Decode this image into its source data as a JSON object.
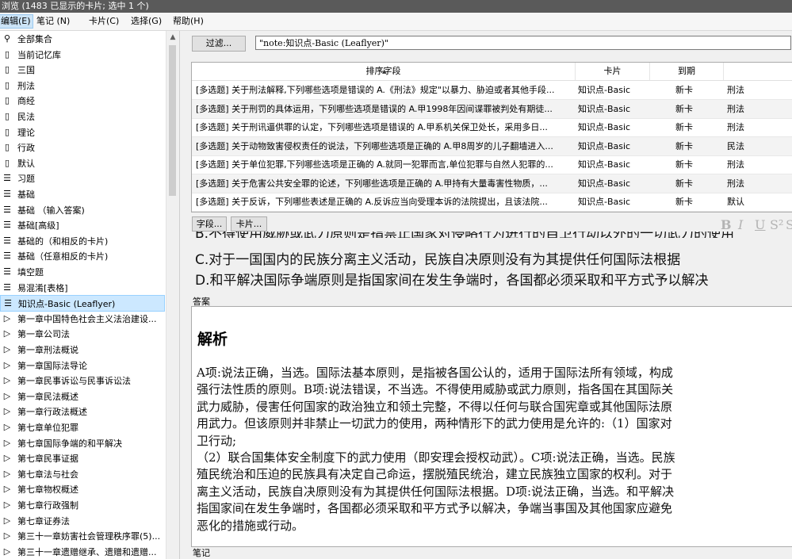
{
  "window": {
    "title": "浏览 (1483 已显示的卡片; 选中 1 个)"
  },
  "menu": [
    {
      "label": "编辑(E)",
      "active": true
    },
    {
      "label": "笔记 (N)"
    },
    {
      "label": "卡片(C)"
    },
    {
      "label": "选择(G)"
    },
    {
      "label": "帮助(H)"
    }
  ],
  "sidebar": {
    "items": [
      {
        "icon": "filter-icon",
        "glyph": "⚲",
        "label": "全部集合"
      },
      {
        "icon": "card-icon",
        "glyph": "▯",
        "label": "当前记忆库"
      },
      {
        "icon": "card-icon",
        "glyph": "▯",
        "label": "三国"
      },
      {
        "icon": "card-icon",
        "glyph": "▯",
        "label": "刑法"
      },
      {
        "icon": "card-icon",
        "glyph": "▯",
        "label": "商经"
      },
      {
        "icon": "card-icon",
        "glyph": "▯",
        "label": "民法"
      },
      {
        "icon": "card-icon",
        "glyph": "▯",
        "label": "理论"
      },
      {
        "icon": "card-icon",
        "glyph": "▯",
        "label": "行政"
      },
      {
        "icon": "card-icon",
        "glyph": "▯",
        "label": "默认"
      },
      {
        "icon": "notetype-icon",
        "glyph": "☰",
        "label": "习题"
      },
      {
        "icon": "notetype-icon",
        "glyph": "☰",
        "label": "基础"
      },
      {
        "icon": "notetype-icon",
        "glyph": "☰",
        "label": "基础 （输入答案)"
      },
      {
        "icon": "notetype-icon",
        "glyph": "☰",
        "label": "基础[高级]"
      },
      {
        "icon": "notetype-icon",
        "glyph": "☰",
        "label": "基础的（和相反的卡片)"
      },
      {
        "icon": "notetype-icon",
        "glyph": "☰",
        "label": "基础（任意相反的卡片)"
      },
      {
        "icon": "notetype-icon",
        "glyph": "☰",
        "label": "填空题"
      },
      {
        "icon": "notetype-icon",
        "glyph": "☰",
        "label": "易混淆[表格]"
      },
      {
        "icon": "notetype-icon",
        "glyph": "☰",
        "label": "知识点-Basic (Leaflyer)",
        "selected": true
      },
      {
        "icon": "tag-icon",
        "glyph": "▷",
        "label": "第一章中国特色社会主义法治建设..."
      },
      {
        "icon": "tag-icon",
        "glyph": "▷",
        "label": "第一章公司法"
      },
      {
        "icon": "tag-icon",
        "glyph": "▷",
        "label": "第一章刑法概说"
      },
      {
        "icon": "tag-icon",
        "glyph": "▷",
        "label": "第一章国际法导论"
      },
      {
        "icon": "tag-icon",
        "glyph": "▷",
        "label": "第一章民事诉讼与民事诉讼法"
      },
      {
        "icon": "tag-icon",
        "glyph": "▷",
        "label": "第一章民法概述"
      },
      {
        "icon": "tag-icon",
        "glyph": "▷",
        "label": "第一章行政法概述"
      },
      {
        "icon": "tag-icon",
        "glyph": "▷",
        "label": "第七章单位犯罪"
      },
      {
        "icon": "tag-icon",
        "glyph": "▷",
        "label": "第七章国际争端的和平解决"
      },
      {
        "icon": "tag-icon",
        "glyph": "▷",
        "label": "第七章民事证据"
      },
      {
        "icon": "tag-icon",
        "glyph": "▷",
        "label": "第七章法与社会"
      },
      {
        "icon": "tag-icon",
        "glyph": "▷",
        "label": "第七章物权概述"
      },
      {
        "icon": "tag-icon",
        "glyph": "▷",
        "label": "第七章行政强制"
      },
      {
        "icon": "tag-icon",
        "glyph": "▷",
        "label": "第七章证券法"
      },
      {
        "icon": "tag-icon",
        "glyph": "▷",
        "label": "第三十一章妨害社会管理秩序罪(5)..."
      },
      {
        "icon": "tag-icon",
        "glyph": "▷",
        "label": "第三十一章遗赠继承、遗赠和遗赠..."
      }
    ]
  },
  "toolbar": {
    "filter_label": "过滤...",
    "search_value": "\"note:知识点-Basic (Leaflyer)\""
  },
  "table": {
    "headers": [
      "排序字段",
      "卡片",
      "到期",
      ""
    ],
    "rows": [
      {
        "sort": "[多选题]    关于刑法解释,下列哪些选项是错误的 A.《刑法》规定\"以暴力、胁迫或者其他手段...",
        "card": "知识点-Basic",
        "due": "新卡",
        "deck": "刑法"
      },
      {
        "sort": "[多选题]    关于刑罚的具体运用，下列哪些选项是错误的 A.甲1998年因间谍罪被判处有期徒...",
        "card": "知识点-Basic",
        "due": "新卡",
        "deck": "刑法"
      },
      {
        "sort": "[多选题]    关于刑讯逼供罪的认定，下列哪些选项是错误的 A.甲系机关保卫处长，采用多日...",
        "card": "知识点-Basic",
        "due": "新卡",
        "deck": "刑法"
      },
      {
        "sort": "[多选题]    关于动物致害侵权责任的说法，下列哪些选项是正确的 A.甲8周岁的儿子翻墙进入...",
        "card": "知识点-Basic",
        "due": "新卡",
        "deck": "民法"
      },
      {
        "sort": "[多选题]    关于单位犯罪,下列哪些选项是正确的 A.就同一犯罪而言,单位犯罪与自然人犯罪的...",
        "card": "知识点-Basic",
        "due": "新卡",
        "deck": "刑法"
      },
      {
        "sort": "[多选题]    关于危害公共安全罪的论述，下列哪些选项是正确的 A.甲持有大量毒害性物质，...",
        "card": "知识点-Basic",
        "due": "新卡",
        "deck": "刑法"
      },
      {
        "sort": "[多选题]    关于反诉，下列哪些表述是正确的 A.反诉应当向受理本诉的法院提出，且该法院...",
        "card": "知识点-Basic",
        "due": "新卡",
        "deck": "默认"
      }
    ]
  },
  "editor": {
    "fields_button": "字段...",
    "cards_button": "卡片...",
    "format": {
      "bold": "B",
      "italic": "I",
      "underline": "U",
      "superscript": "S²",
      "subscript": "S"
    },
    "question_cut": "B.不得使用威胁或武力原则是指禁止国家对侵略行为进行的自卫行动以外的一切武力的使用",
    "question_lines": [
      "C.对于一国国内的民族分离主义活动，民族自决原则没有为其提供任何国际法根据",
      "D.和平解决国际争端原则是指国家间在发生争端时，各国都必须采取和平方式予以解决"
    ],
    "answer_label": "答案",
    "answer_heading": "解析",
    "answer_lines": [
      "A项:说法正确，当选。国际法基本原则，是指被各国公认的，适用于国际法所有领域，构成",
      "强行法性质的原则。B项:说法错误，不当选。不得使用威胁或武力原则，指各国在其国际关",
      "武力威胁，侵害任何国家的政治独立和领土完整，不得以任何与联合国宪章或其他国际法原",
      "用武力。但该原则并非禁止一切武力的使用，两种情形下的武力使用是允许的:（1）国家对",
      "卫行动;",
      "（2）联合国集体安全制度下的武力使用（即安理会授权动武）。C项:说法正确，当选。民族",
      "殖民统治和压迫的民族具有决定自己命运，摆脱殖民统治，建立民族独立国家的权利。对于",
      "离主义活动，民族自决原则没有为其提供任何国际法根据。D项:说法正确，当选。和平解决",
      "指国家间在发生争端时，各国都必须采取和平方式予以解决，争端当事国及其他国家应避免",
      "恶化的措施或行动。"
    ],
    "notes_label": "笔记"
  }
}
